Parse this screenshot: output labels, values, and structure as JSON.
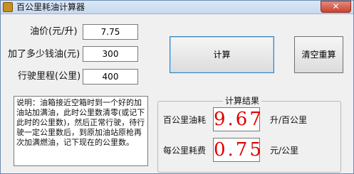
{
  "window": {
    "title": "百公里耗油计算器",
    "close_label": "✕"
  },
  "inputs": {
    "price": {
      "label": "油价(元/升)",
      "value": "7.75"
    },
    "fuel_money": {
      "label": "加了多少钱油(元)",
      "value": "300"
    },
    "distance": {
      "label": "行驶里程(公里)",
      "value": "400"
    }
  },
  "buttons": {
    "calculate": "计算",
    "clear": "清空重算"
  },
  "description": "说明：油箱接近空箱时到一个好的加油站加满油，此时公里数清零(或记下此时的公里数)，然后正常行驶，待行驶一定公里数后，到原加油站原枪再次加满燃油，记下现在的公里数。",
  "results": {
    "group_title": "计算结果",
    "per_100km": {
      "label": "百公里油耗",
      "value": "9.67",
      "unit": "升/百公里"
    },
    "per_km": {
      "label": "每公里耗费",
      "value": "0.75",
      "unit": "元/公里"
    }
  }
}
